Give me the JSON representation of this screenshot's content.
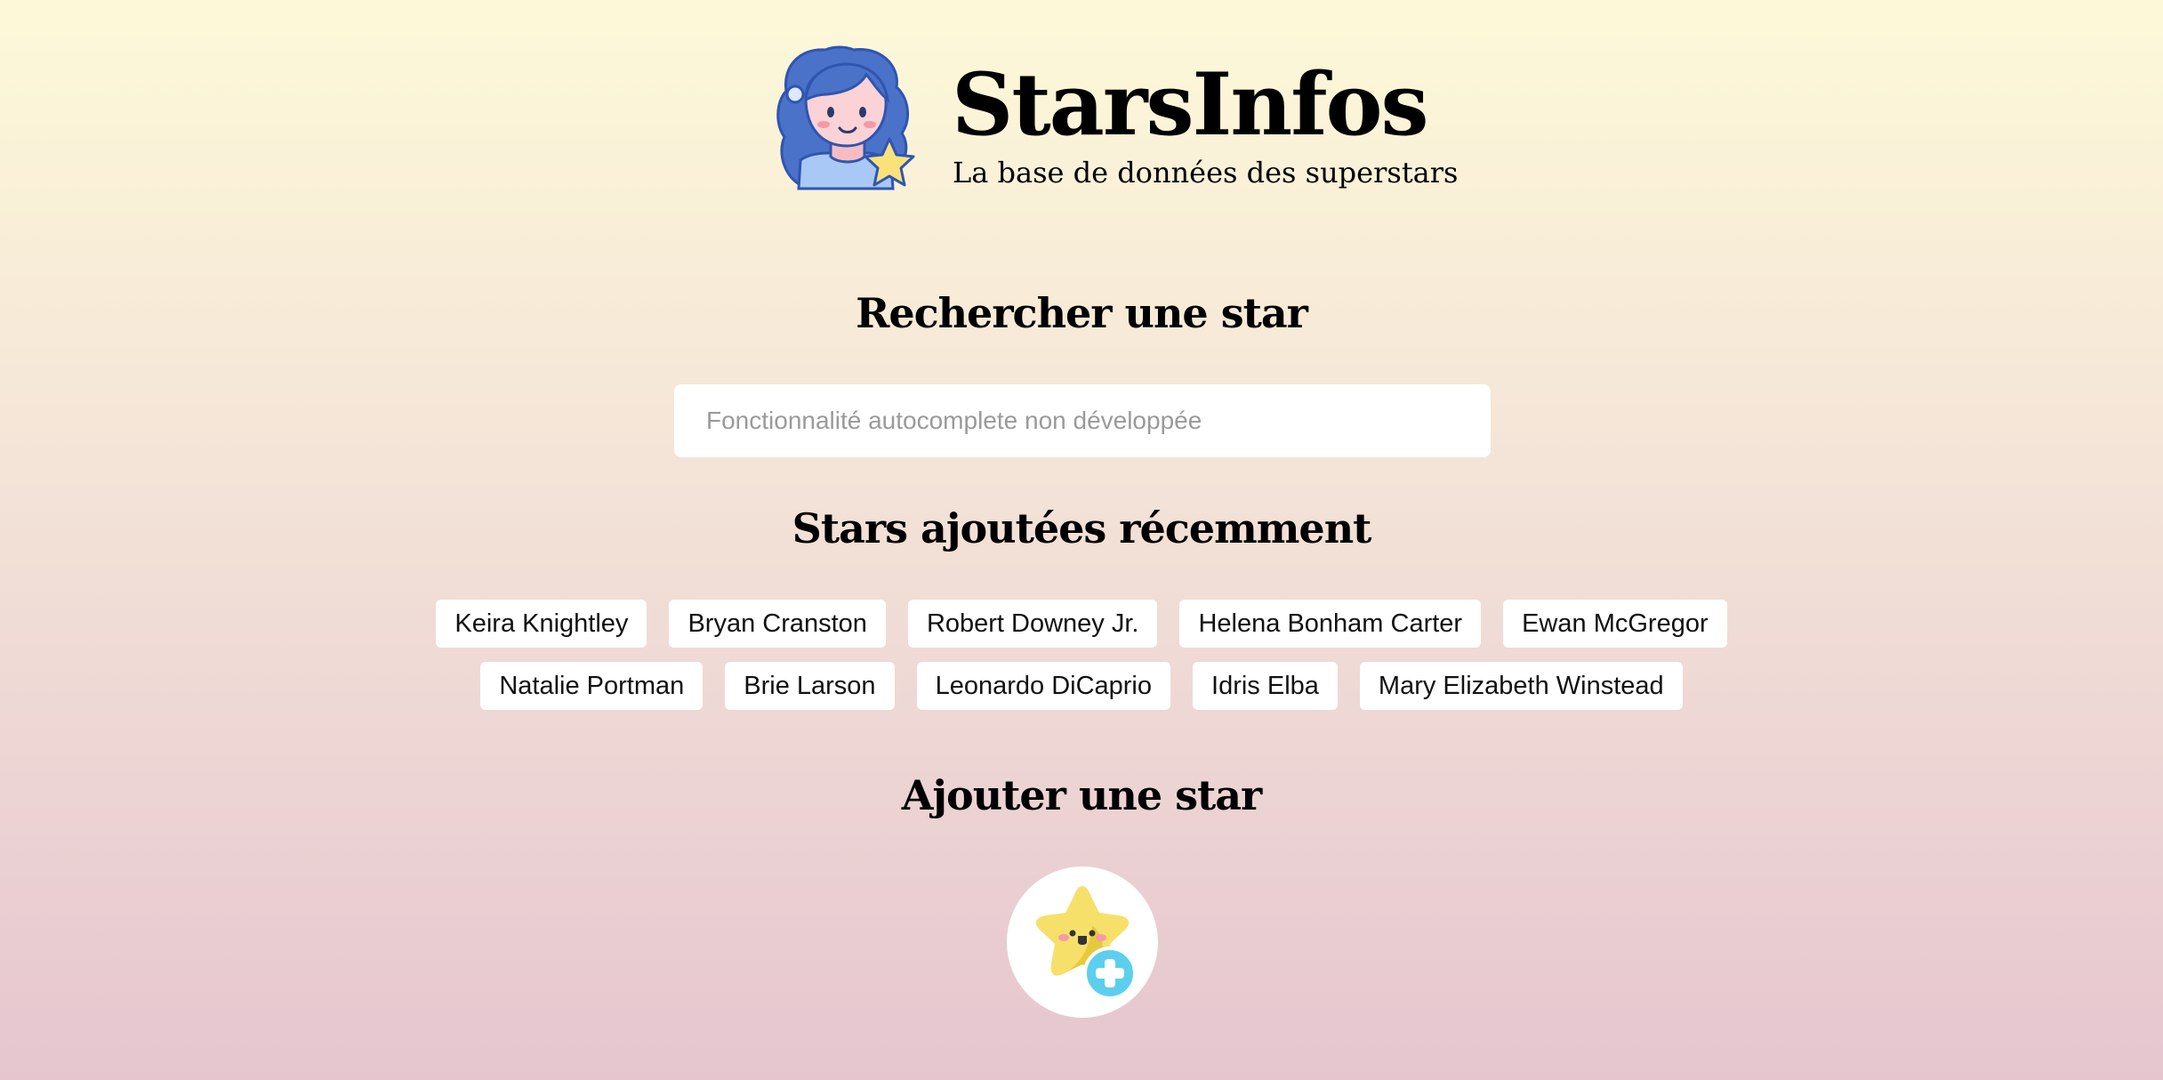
{
  "header": {
    "title": "StarsInfos",
    "subtitle": "La base de données des superstars",
    "logo_icon": "woman-with-star-avatar-icon"
  },
  "search": {
    "heading": "Rechercher une star",
    "placeholder": "Fonctionnalité autocomplete non développée",
    "value": ""
  },
  "recent": {
    "heading": "Stars ajoutées récemment",
    "rows": [
      [
        "Keira Knightley",
        "Bryan Cranston",
        "Robert Downey Jr.",
        "Helena Bonham Carter",
        "Ewan McGregor"
      ],
      [
        "Natalie Portman",
        "Brie Larson",
        "Leonardo DiCaprio",
        "Idris Elba",
        "Mary Elizabeth Winstead"
      ]
    ]
  },
  "add": {
    "heading": "Ajouter une star",
    "icon": "star-add-icon"
  },
  "colors": {
    "background_top": "#fdf9d8",
    "background_bottom": "#e6c5cf",
    "card": "#ffffff",
    "logo_hair": "#4a72c8",
    "logo_skin": "#f9c8cc",
    "star_yellow": "#f7e06a",
    "plus_cyan": "#5ccfee"
  }
}
